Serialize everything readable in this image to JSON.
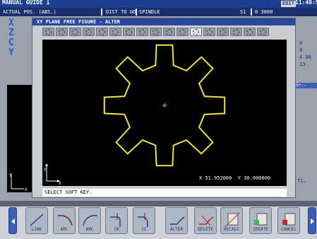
{
  "header": {
    "title": "MANUAL GUIDE i",
    "mode": "EDIT",
    "time": "11:48:5"
  },
  "infobar": {
    "pos_label": "ACTUAL POS. (ABS.)",
    "dist_label": "DIST TO GO",
    "spindle_label": "SPINDLE",
    "spindle_id": "S1",
    "spindle_value": "0 3000"
  },
  "axes": [
    "X",
    "Z",
    "C",
    "Y"
  ],
  "right_values": [
    "0",
    "0",
    "4 88",
    "13."
  ],
  "right_panel_label": "G+--",
  "t_label": "T1.",
  "dialog": {
    "title": "XY PLANE FREE FIGURE - ALTER",
    "selected_icon_index": 11,
    "coordinates": "X 51.952000  Y 30.000000",
    "prompt": "SELECT SOFT KEY."
  },
  "figure": {
    "shape": "gear",
    "teeth": 8,
    "color": "#f2e13c"
  },
  "softkeys": [
    {
      "label": "LINE",
      "icon": "line-icon"
    },
    {
      "label": "ARC",
      "icon": "arc-cw-icon"
    },
    {
      "label": "ARC",
      "icon": "arc-ccw-icon"
    },
    {
      "label": "CR",
      "icon": "corner-r-icon"
    },
    {
      "label": "CC",
      "icon": "corner-c-icon"
    },
    {
      "label": "ALTER",
      "icon": "alter-icon"
    },
    {
      "label": "DELETE",
      "icon": "delete-icon"
    },
    {
      "label": "RECALC",
      "icon": "recalc-icon"
    },
    {
      "label": "CREATE",
      "icon": "create-icon"
    },
    {
      "label": "CANCEL",
      "icon": "cancel-icon"
    }
  ]
}
